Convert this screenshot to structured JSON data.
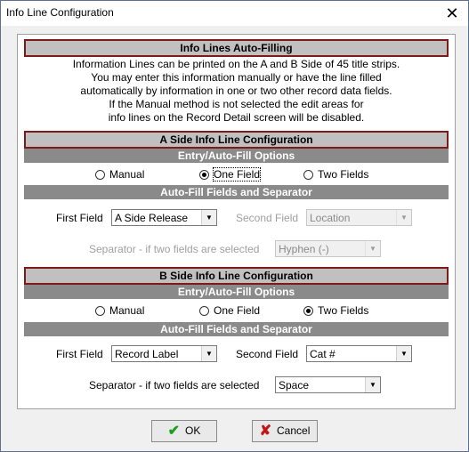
{
  "window": {
    "title": "Info Line Configuration",
    "close_glyph": "✕"
  },
  "auto_fill": {
    "header": "Info Lines Auto-Filling",
    "description_lines": [
      "Information Lines can be printed on the A and B Side of 45 title strips.",
      "You may enter this information manually or have the line filled",
      "automatically by information in one or two other record data fields.",
      "If the Manual method is not selected the edit areas for",
      "info lines on the Record Detail screen will be disabled."
    ]
  },
  "a_side": {
    "header": "A Side Info Line Configuration",
    "entry_header": "Entry/Auto-Fill Options",
    "options": [
      {
        "label": "Manual",
        "selected": false
      },
      {
        "label": "One Field",
        "selected": true
      },
      {
        "label": "Two Fields",
        "selected": false
      }
    ],
    "fields_header": "Auto-Fill Fields and Separator",
    "first_field_label": "First Field",
    "first_field_value": "A Side Release",
    "second_field_label": "Second Field",
    "second_field_value": "Location",
    "separator_label": "Separator - if two fields are selected",
    "separator_value": "Hyphen (-)"
  },
  "b_side": {
    "header": "B Side Info Line Configuration",
    "entry_header": "Entry/Auto-Fill Options",
    "options": [
      {
        "label": "Manual",
        "selected": false
      },
      {
        "label": "One Field",
        "selected": false
      },
      {
        "label": "Two Fields",
        "selected": true
      }
    ],
    "fields_header": "Auto-Fill Fields and Separator",
    "first_field_label": "First Field",
    "first_field_value": "Record Label",
    "second_field_label": "Second Field",
    "second_field_value": "Cat #",
    "separator_label": "Separator - if two fields are selected",
    "separator_value": "Space"
  },
  "buttons": {
    "ok": "OK",
    "cancel": "Cancel"
  },
  "icons": {
    "ok": "checkmark-icon",
    "cancel": "x-icon",
    "dropdown": "chevron-down-icon"
  },
  "colors": {
    "section_border": "#7f1a1a",
    "subheader_bg": "#8a8a8a",
    "ok_icon": "#1aa01a",
    "cancel_icon": "#c01818"
  }
}
